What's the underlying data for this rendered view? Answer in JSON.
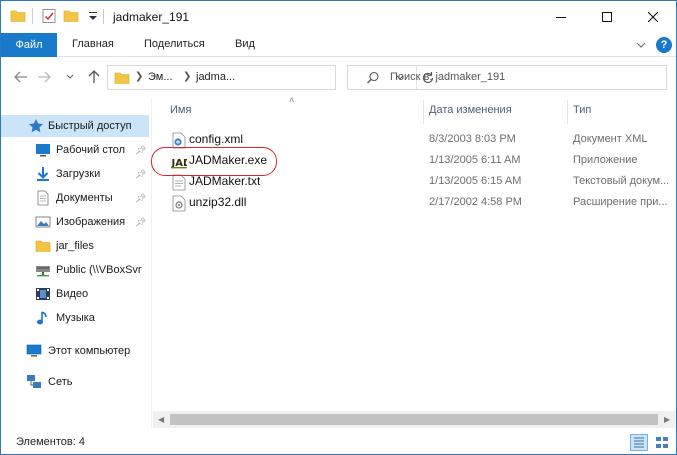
{
  "window": {
    "title": "jadmaker_191"
  },
  "ribbon": {
    "tabs": [
      {
        "label": "Файл"
      },
      {
        "label": "Главная"
      },
      {
        "label": "Поделиться"
      },
      {
        "label": "Вид"
      }
    ],
    "help": "?"
  },
  "address": {
    "segments": [
      "Эм...",
      "jadma..."
    ],
    "search_placeholder": "Поиск в: jadmaker_191"
  },
  "sidebar": {
    "items": [
      {
        "label": "Быстрый доступ",
        "icon": "star-icon",
        "selected": true
      },
      {
        "label": "Рабочий стол",
        "icon": "desktop-icon",
        "pinned": true
      },
      {
        "label": "Загрузки",
        "icon": "download-icon",
        "pinned": true
      },
      {
        "label": "Документы",
        "icon": "documents-icon",
        "pinned": true
      },
      {
        "label": "Изображения",
        "icon": "pictures-icon",
        "pinned": true
      },
      {
        "label": "jar_files",
        "icon": "folder-icon"
      },
      {
        "label": "Public (\\\\VBoxSvr",
        "icon": "network-drive-icon"
      },
      {
        "label": "Видео",
        "icon": "video-icon"
      },
      {
        "label": "Музыка",
        "icon": "music-icon"
      },
      {
        "label": "Этот компьютер",
        "icon": "computer-icon"
      },
      {
        "label": "Сеть",
        "icon": "network-icon"
      }
    ]
  },
  "list": {
    "columns": {
      "name": "Имя",
      "date": "Дата изменения",
      "type": "Тип"
    },
    "files": [
      {
        "name": "config.xml",
        "date": "8/3/2003 8:03 PM",
        "type": "Документ XML",
        "icon": "xml-file-icon"
      },
      {
        "name": "JADMaker.exe",
        "date": "1/13/2005 6:11 AM",
        "type": "Приложение",
        "icon": "exe-file-icon",
        "highlighted": true
      },
      {
        "name": "JADMaker.txt",
        "date": "1/13/2005 6:15 AM",
        "type": "Текстовый докум...",
        "icon": "txt-file-icon"
      },
      {
        "name": "unzip32.dll",
        "date": "2/17/2002 4:58 PM",
        "type": "Расширение при...",
        "icon": "dll-file-icon"
      }
    ]
  },
  "status": {
    "count": "Элементов: 4"
  },
  "colors": {
    "accent": "#1979ca",
    "selection": "#cce4f7",
    "highlight_ring": "#d7262c",
    "folder": "#f3c544"
  }
}
